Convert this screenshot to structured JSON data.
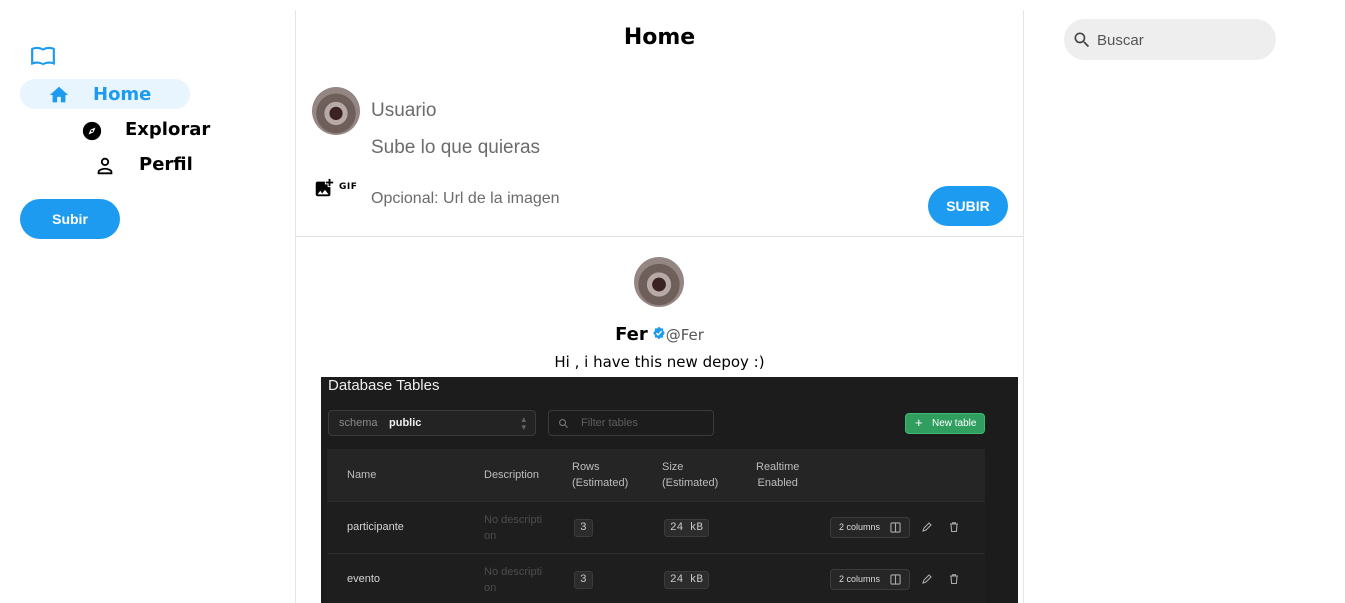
{
  "nav": {
    "logo_icon": "book-open-icon",
    "items": [
      {
        "label": "Home",
        "icon": "home-icon",
        "active": true
      },
      {
        "label": "Explorar",
        "icon": "compass-icon"
      },
      {
        "label": "Perfil",
        "icon": "user-icon"
      }
    ],
    "subir_label": "Subir"
  },
  "main": {
    "title": "Home",
    "composer": {
      "user_placeholder": "Usuario",
      "text_placeholder": "Sube lo que quieras",
      "url_placeholder": "Opcional: Url de la imagen",
      "gif_label": "GIF",
      "submit_label": "SUBIR"
    },
    "post": {
      "name": "Fer",
      "handle": "@Fer",
      "text": "Hi , i have this new depoy :)",
      "image": {
        "title": "Database Tables",
        "schema_label": "schema",
        "schema_value": "public",
        "filter_placeholder": "Filter tables",
        "new_table_label": "New table",
        "columns": {
          "name": "Name",
          "description": "Description",
          "rows_1": "Rows",
          "rows_2": "(Estimated)",
          "size_1": "Size",
          "size_2": "(Estimated)",
          "realtime_1": "Realtime",
          "realtime_2": "Enabled"
        },
        "rows": [
          {
            "name": "participante",
            "desc_1": "No descripti",
            "desc_2": "on",
            "rows": "3",
            "size": "24 kB",
            "columns": "2 columns"
          },
          {
            "name": "evento",
            "desc_1": "No descripti",
            "desc_2": "on",
            "rows": "3",
            "size": "24 kB",
            "columns": "2 columns"
          }
        ]
      }
    }
  },
  "search": {
    "placeholder": "Buscar"
  },
  "colors": {
    "accent": "#1d9bf0",
    "active_bg": "#e8f5fe",
    "db_bg": "#1c1c1c",
    "db_green": "#2f9e5e"
  }
}
